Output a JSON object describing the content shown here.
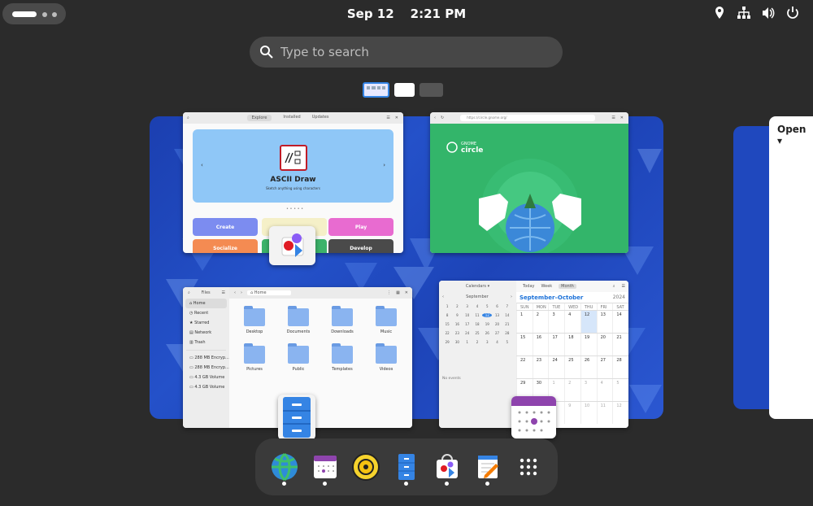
{
  "topbar": {
    "date": "Sep 12",
    "time": "2:21 PM",
    "system_icons": [
      "location-icon",
      "network-icon",
      "volume-icon",
      "power-icon"
    ]
  },
  "search": {
    "placeholder": "Type to search"
  },
  "workspaces": {
    "active_index": 0,
    "count": 3
  },
  "windows": {
    "software": {
      "tabs": [
        "Explore",
        "Installed",
        "Updates"
      ],
      "active_tab": "Explore",
      "banner_title": "ASCII Draw",
      "banner_subtitle": "Sketch anything using characters",
      "categories": [
        {
          "label": "Create",
          "color": "#7c8cf0"
        },
        {
          "label": "Play",
          "color": "#e86bd0"
        },
        {
          "label": "Socialize",
          "color": "#f48b52"
        },
        {
          "label": "Develop",
          "color": "#4a4a4a"
        }
      ]
    },
    "browser": {
      "url": "https://circle.gnome.org/",
      "brand_top": "GNOME",
      "brand_name": "circle"
    },
    "files": {
      "title": "Files",
      "location": "Home",
      "sidebar": [
        "Home",
        "Recent",
        "Starred",
        "Network",
        "Trash",
        "288 MB Encryp...",
        "288 MB Encryp...",
        "4.3 GB Volume",
        "4.3 GB Volume"
      ],
      "folders": [
        "Desktop",
        "Documents",
        "Downloads",
        "Music",
        "Pictures",
        "Public",
        "Templates",
        "Videos"
      ]
    },
    "calendar": {
      "title": "Calendars",
      "view_tabs": [
        "Today",
        "Week",
        "Month"
      ],
      "active_view": "Month",
      "mini_month": "September",
      "no_events": "No events",
      "month_title": "September–October",
      "year": "2024",
      "weekdays": [
        "SUN",
        "MON",
        "TUE",
        "WED",
        "THU",
        "FRI",
        "SAT"
      ],
      "weeks": [
        [
          "1",
          "2",
          "3",
          "4",
          "12",
          "13",
          "14"
        ],
        [
          "15",
          "16",
          "17",
          "18",
          "19",
          "20",
          "21"
        ],
        [
          "22",
          "23",
          "24",
          "25",
          "26",
          "27",
          "28"
        ],
        [
          "29",
          "30",
          "1",
          "2",
          "3",
          "4",
          "5"
        ],
        [
          "6",
          "7",
          "8",
          "9",
          "10",
          "11",
          "12"
        ]
      ],
      "mini_days": [
        [
          "1",
          "2",
          "3",
          "4",
          "5",
          "6",
          "7"
        ],
        [
          "8",
          "9",
          "10",
          "11",
          "12",
          "13",
          "14"
        ],
        [
          "15",
          "16",
          "17",
          "18",
          "19",
          "20",
          "21"
        ],
        [
          "22",
          "23",
          "24",
          "25",
          "26",
          "27",
          "28"
        ],
        [
          "29",
          "30",
          "1",
          "2",
          "3",
          "4",
          "5"
        ]
      ]
    }
  },
  "side_window": {
    "label": "Open"
  },
  "dash": {
    "apps": [
      {
        "name": "web-browser-icon",
        "running": true
      },
      {
        "name": "calendar-icon",
        "running": true
      },
      {
        "name": "rhythmbox-icon",
        "running": false
      },
      {
        "name": "files-icon",
        "running": true
      },
      {
        "name": "software-icon",
        "running": true
      },
      {
        "name": "text-editor-icon",
        "running": true
      },
      {
        "name": "app-grid-icon",
        "running": false
      }
    ]
  }
}
